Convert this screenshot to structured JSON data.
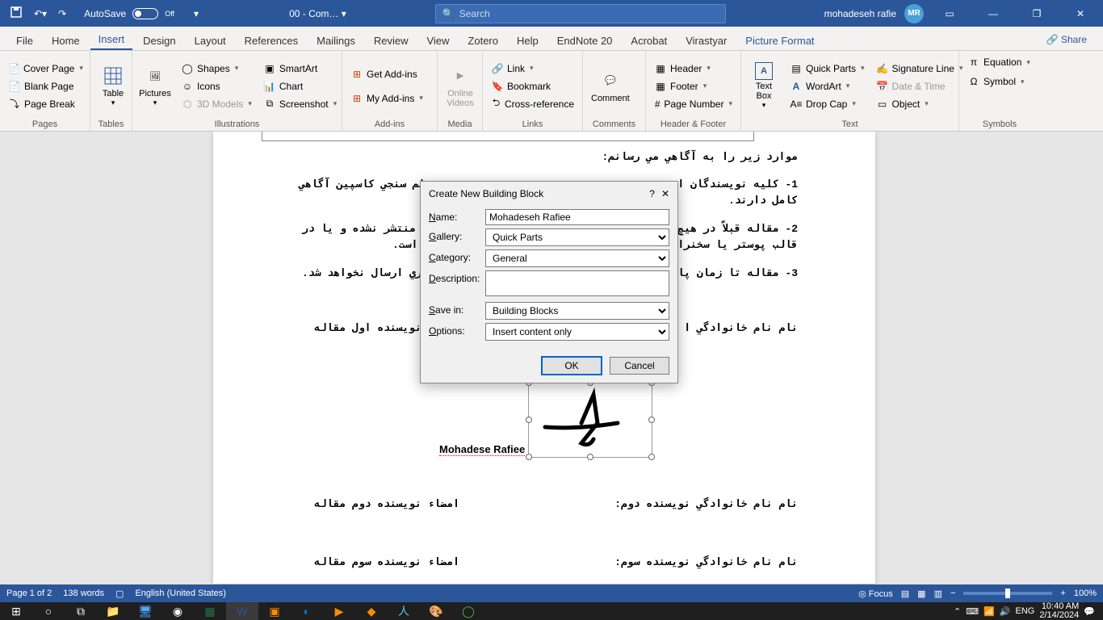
{
  "titlebar": {
    "autosave_label": "AutoSave",
    "autosave_state": "Off",
    "doc_name": "00  -  Com… ",
    "search_placeholder": "Search",
    "user_name": "mohadeseh rafie",
    "user_initials": "MR"
  },
  "tabs": {
    "items": [
      "File",
      "Home",
      "Insert",
      "Design",
      "Layout",
      "References",
      "Mailings",
      "Review",
      "View",
      "Zotero",
      "Help",
      "EndNote 20",
      "Acrobat",
      "Virastyar",
      "Picture Format"
    ],
    "active": "Insert",
    "share": "Share"
  },
  "ribbon": {
    "pages": {
      "cover": "Cover Page",
      "blank": "Blank Page",
      "break": "Page Break",
      "label": "Pages"
    },
    "tables": {
      "table": "Table",
      "label": "Tables"
    },
    "illus": {
      "pictures": "Pictures",
      "shapes": "Shapes",
      "icons": "Icons",
      "models": "3D Models",
      "smartart": "SmartArt",
      "chart": "Chart",
      "screenshot": "Screenshot",
      "label": "Illustrations"
    },
    "addins": {
      "get": "Get Add-ins",
      "my": "My Add-ins",
      "label": "Add-ins"
    },
    "media": {
      "video": "Online\nVideos",
      "label": "Media"
    },
    "links": {
      "link": "Link",
      "bookmark": "Bookmark",
      "cross": "Cross-reference",
      "label": "Links"
    },
    "comments": {
      "comment": "Comment",
      "label": "Comments"
    },
    "hf": {
      "header": "Header",
      "footer": "Footer",
      "pagenum": "Page Number",
      "label": "Header & Footer"
    },
    "text": {
      "textbox": "Text\nBox",
      "quick": "Quick Parts",
      "wordart": "WordArt",
      "dropcap": "Drop Cap",
      "sigline": "Signature Line",
      "datetime": "Date & Time",
      "object": "Object",
      "label": "Text"
    },
    "symbols": {
      "equation": "Equation",
      "symbol": "Symbol",
      "label": "Symbols"
    }
  },
  "document": {
    "line0": "موارد زير را به آگاهي مي رسانم:",
    "line1": "1- كليه نويسندگان ا",
    "line1b": "علم سنجي كاسپين آگاهي",
    "line1c": "كامل دارند.",
    "line2": "2- مقاله قبلاً در هيچ",
    "line2b": "تاب منتشر نشده و يا در",
    "line2c": "قالب پوستر يا سخنرا",
    "line2d": "شده است.",
    "line3": "3- مقاله تا زمان پا",
    "line3b": "ديگري ارسال نخواهد شد.",
    "sig1_name": "نام نام خانوادگي ا",
    "sig1_sign": "نويسنده اول مقاله",
    "sig_label": "Mohadese Rafiee",
    "sig2_name": "نام نام خانوادگي نويسنده دوم:",
    "sig2_sign": "امضاء نويسنده دوم مقاله",
    "sig3_name": "نام نام خانوادگي نويسنده سوم:",
    "sig3_sign": "امضاء نويسنده سوم مقاله"
  },
  "dialog": {
    "title": "Create New Building Block",
    "name_label": "Name:",
    "name_value": "Mohadeseh Rafiee",
    "gallery_label": "Gallery:",
    "gallery_value": "Quick Parts",
    "category_label": "Category:",
    "category_value": "General",
    "description_label": "Description:",
    "savein_label": "Save in:",
    "savein_value": "Building Blocks",
    "options_label": "Options:",
    "options_value": "Insert content only",
    "ok": "OK",
    "cancel": "Cancel"
  },
  "status": {
    "page": "Page 1 of 2",
    "words": "138 words",
    "lang": "English (United States)",
    "focus": "Focus",
    "zoom": "100%"
  },
  "taskbar": {
    "lang": "ENG",
    "time": "10:40 AM",
    "date": "2/14/2024"
  }
}
